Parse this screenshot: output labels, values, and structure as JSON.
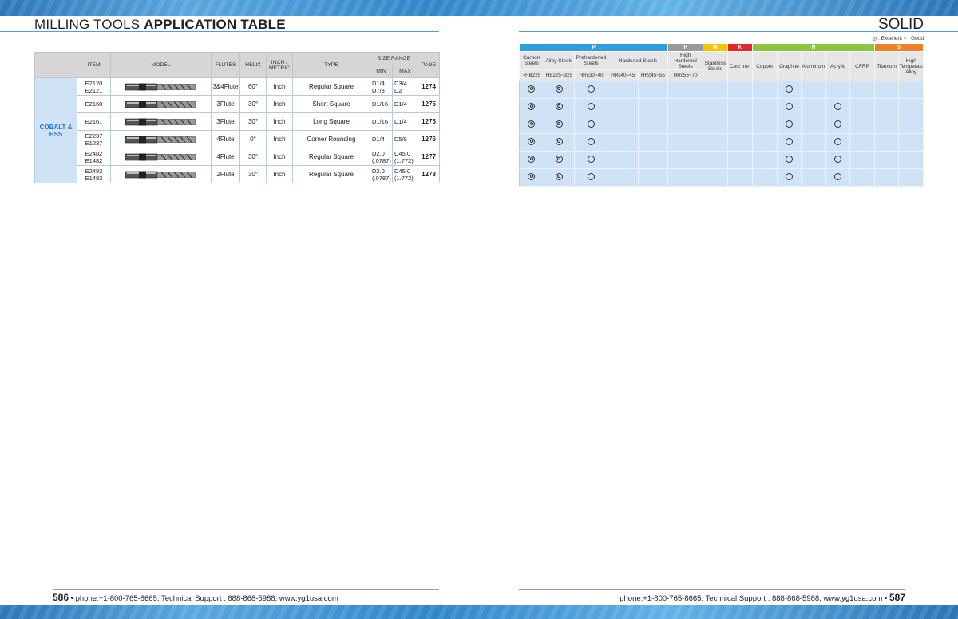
{
  "header": {
    "title_plain": "MILLING TOOLS ",
    "title_bold": "APPLICATION TABLE",
    "right_title": "SOLID",
    "legend": "◎ : Excellent  ○ : Good"
  },
  "left_table": {
    "headers": {
      "item": "ITEM",
      "model": "MODEL",
      "flutes": "FLUTES",
      "helix": "HELIX",
      "inch_metric": "INCH / METRIC",
      "type": "TYPE",
      "size_range": "SIZE RANGE",
      "min": "MIN",
      "max": "MAX",
      "page": "PAGE"
    },
    "category": "COBALT & HSS",
    "rows": [
      {
        "item1": "E2120",
        "item2": "E2121",
        "tool": "3-flute-end-mill-image",
        "flutes": "3&4Flute",
        "helix": "60°",
        "unit": "Inch",
        "type": "Regular Square",
        "min1": "D1/4",
        "min2": "D7/8",
        "max1": "D3/4",
        "max2": "D2",
        "page": "1274"
      },
      {
        "item1": "E2160",
        "item2": "",
        "tool": "short-end-mill-image",
        "flutes": "3Flute",
        "helix": "30°",
        "unit": "Inch",
        "type": "Short Square",
        "min1": "D1/16",
        "min2": "",
        "max1": "D1/4",
        "max2": "",
        "page": "1275"
      },
      {
        "item1": "E2161",
        "item2": "",
        "tool": "long-end-mill-image",
        "flutes": "3Flute",
        "helix": "30°",
        "unit": "Inch",
        "type": "Long Square",
        "min1": "D1/16",
        "min2": "",
        "max1": "D1/4",
        "max2": "",
        "page": "1275"
      },
      {
        "item1": "E2237",
        "item2": "E1237",
        "tool": "corner-rounding-mill-image",
        "flutes": "4Flute",
        "helix": "0°",
        "unit": "Inch",
        "type": "Corner Rounding",
        "min1": "D1/4",
        "min2": "",
        "max1": "D5/8",
        "max2": "",
        "page": "1276"
      },
      {
        "item1": "E2482",
        "item2": "E1482",
        "tool": "4-flute-end-mill-image",
        "flutes": "4Flute",
        "helix": "30°",
        "unit": "Inch",
        "type": "Regular Square",
        "min1": "D2.0",
        "min2": "(.0787)",
        "max1": "D45.0",
        "max2": "(1.772)",
        "page": "1277"
      },
      {
        "item1": "E2483",
        "item2": "E1483",
        "tool": "2-flute-end-mill-image",
        "flutes": "2Flute",
        "helix": "30°",
        "unit": "Inch",
        "type": "Regular Square",
        "min1": "D2.0",
        "min2": "(.0787)",
        "max1": "D45.0",
        "max2": "(1.772)",
        "page": "1278"
      }
    ]
  },
  "right_table": {
    "groups": [
      {
        "label": "P",
        "color": "#2e9fdc"
      },
      {
        "label": "H",
        "color": "#9a9a9a"
      },
      {
        "label": "M",
        "color": "#f2c500"
      },
      {
        "label": "K",
        "color": "#e8242b"
      },
      {
        "label": "N",
        "color": "#8cc63f"
      },
      {
        "label": "S",
        "color": "#f07f2a"
      }
    ],
    "materials": {
      "carbon": "Carbon Steels",
      "alloy": "Alloy Steels",
      "prehardened": "Prehardened Steels",
      "hardened": "Hardened Steels",
      "high_hardened": "High Hardened Steels",
      "stainless": "Stainless Steels",
      "cast_iron": "Cast Iron",
      "copper": "Copper",
      "graphite": "Graphite",
      "aluminum": "Aluminum",
      "acrylic": "Acrylic",
      "cfrp": "CFRP",
      "titanium": "Titanium",
      "high_temp": "High Temperature Alloy"
    },
    "hardness": {
      "carbon": "~HB225",
      "alloy": "HB225~325",
      "prehardened": "HRc30~40",
      "hardened1": "HRc40~45",
      "hardened2": "HRc45~55",
      "high_hardened": "HRc55~70"
    },
    "rows": [
      [
        "exc",
        "exc",
        "good",
        "",
        "",
        "",
        "",
        "",
        "",
        "good",
        "",
        "",
        "",
        "",
        "",
        ""
      ],
      [
        "exc",
        "exc",
        "good",
        "",
        "",
        "",
        "",
        "",
        "",
        "good",
        "",
        "good",
        "",
        "",
        "",
        ""
      ],
      [
        "exc",
        "exc",
        "good",
        "",
        "",
        "",
        "",
        "",
        "",
        "good",
        "",
        "good",
        "",
        "",
        "",
        ""
      ],
      [
        "exc",
        "exc",
        "good",
        "",
        "",
        "",
        "",
        "",
        "",
        "good",
        "",
        "good",
        "",
        "",
        "",
        ""
      ],
      [
        "exc",
        "exc",
        "good",
        "",
        "",
        "",
        "",
        "",
        "",
        "good",
        "",
        "good",
        "",
        "",
        "",
        ""
      ],
      [
        "exc",
        "exc",
        "good",
        "",
        "",
        "",
        "",
        "",
        "",
        "good",
        "",
        "good",
        "",
        "",
        "",
        ""
      ]
    ]
  },
  "footer": {
    "left_page": "586",
    "right_page": "587",
    "contact": "phone:+1-800-765-8665,  Technical Support : 888-868-5988,  www.yg1usa.com",
    "dot": "•"
  }
}
